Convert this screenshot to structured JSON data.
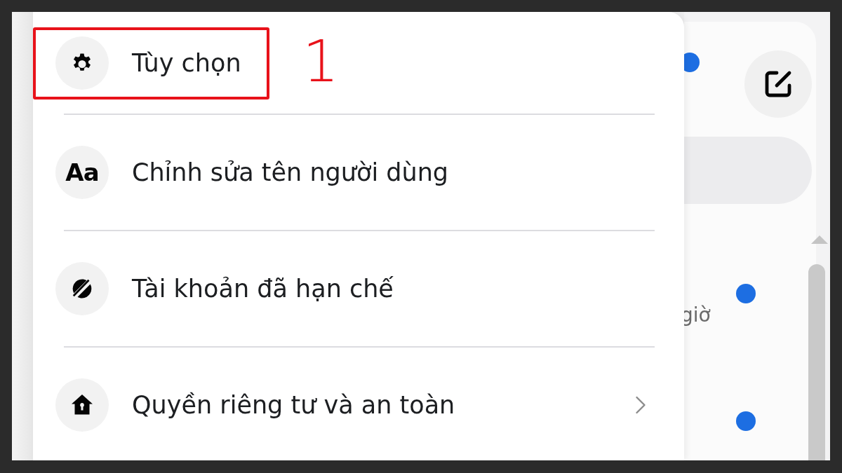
{
  "menu": {
    "items": [
      {
        "label": "Tùy chọn",
        "has_submenu": false,
        "highlighted": true
      },
      {
        "label": "Chỉnh sửa tên người dùng",
        "icon_text": "Aa",
        "has_submenu": false,
        "highlighted": false
      },
      {
        "label": "Tài khoản đã hạn chế",
        "has_submenu": false,
        "highlighted": false
      },
      {
        "label": "Quyền riêng tư và an toàn",
        "has_submenu": true,
        "highlighted": false
      }
    ]
  },
  "annotation": {
    "label": "1"
  },
  "background": {
    "snippet": "giờ"
  }
}
